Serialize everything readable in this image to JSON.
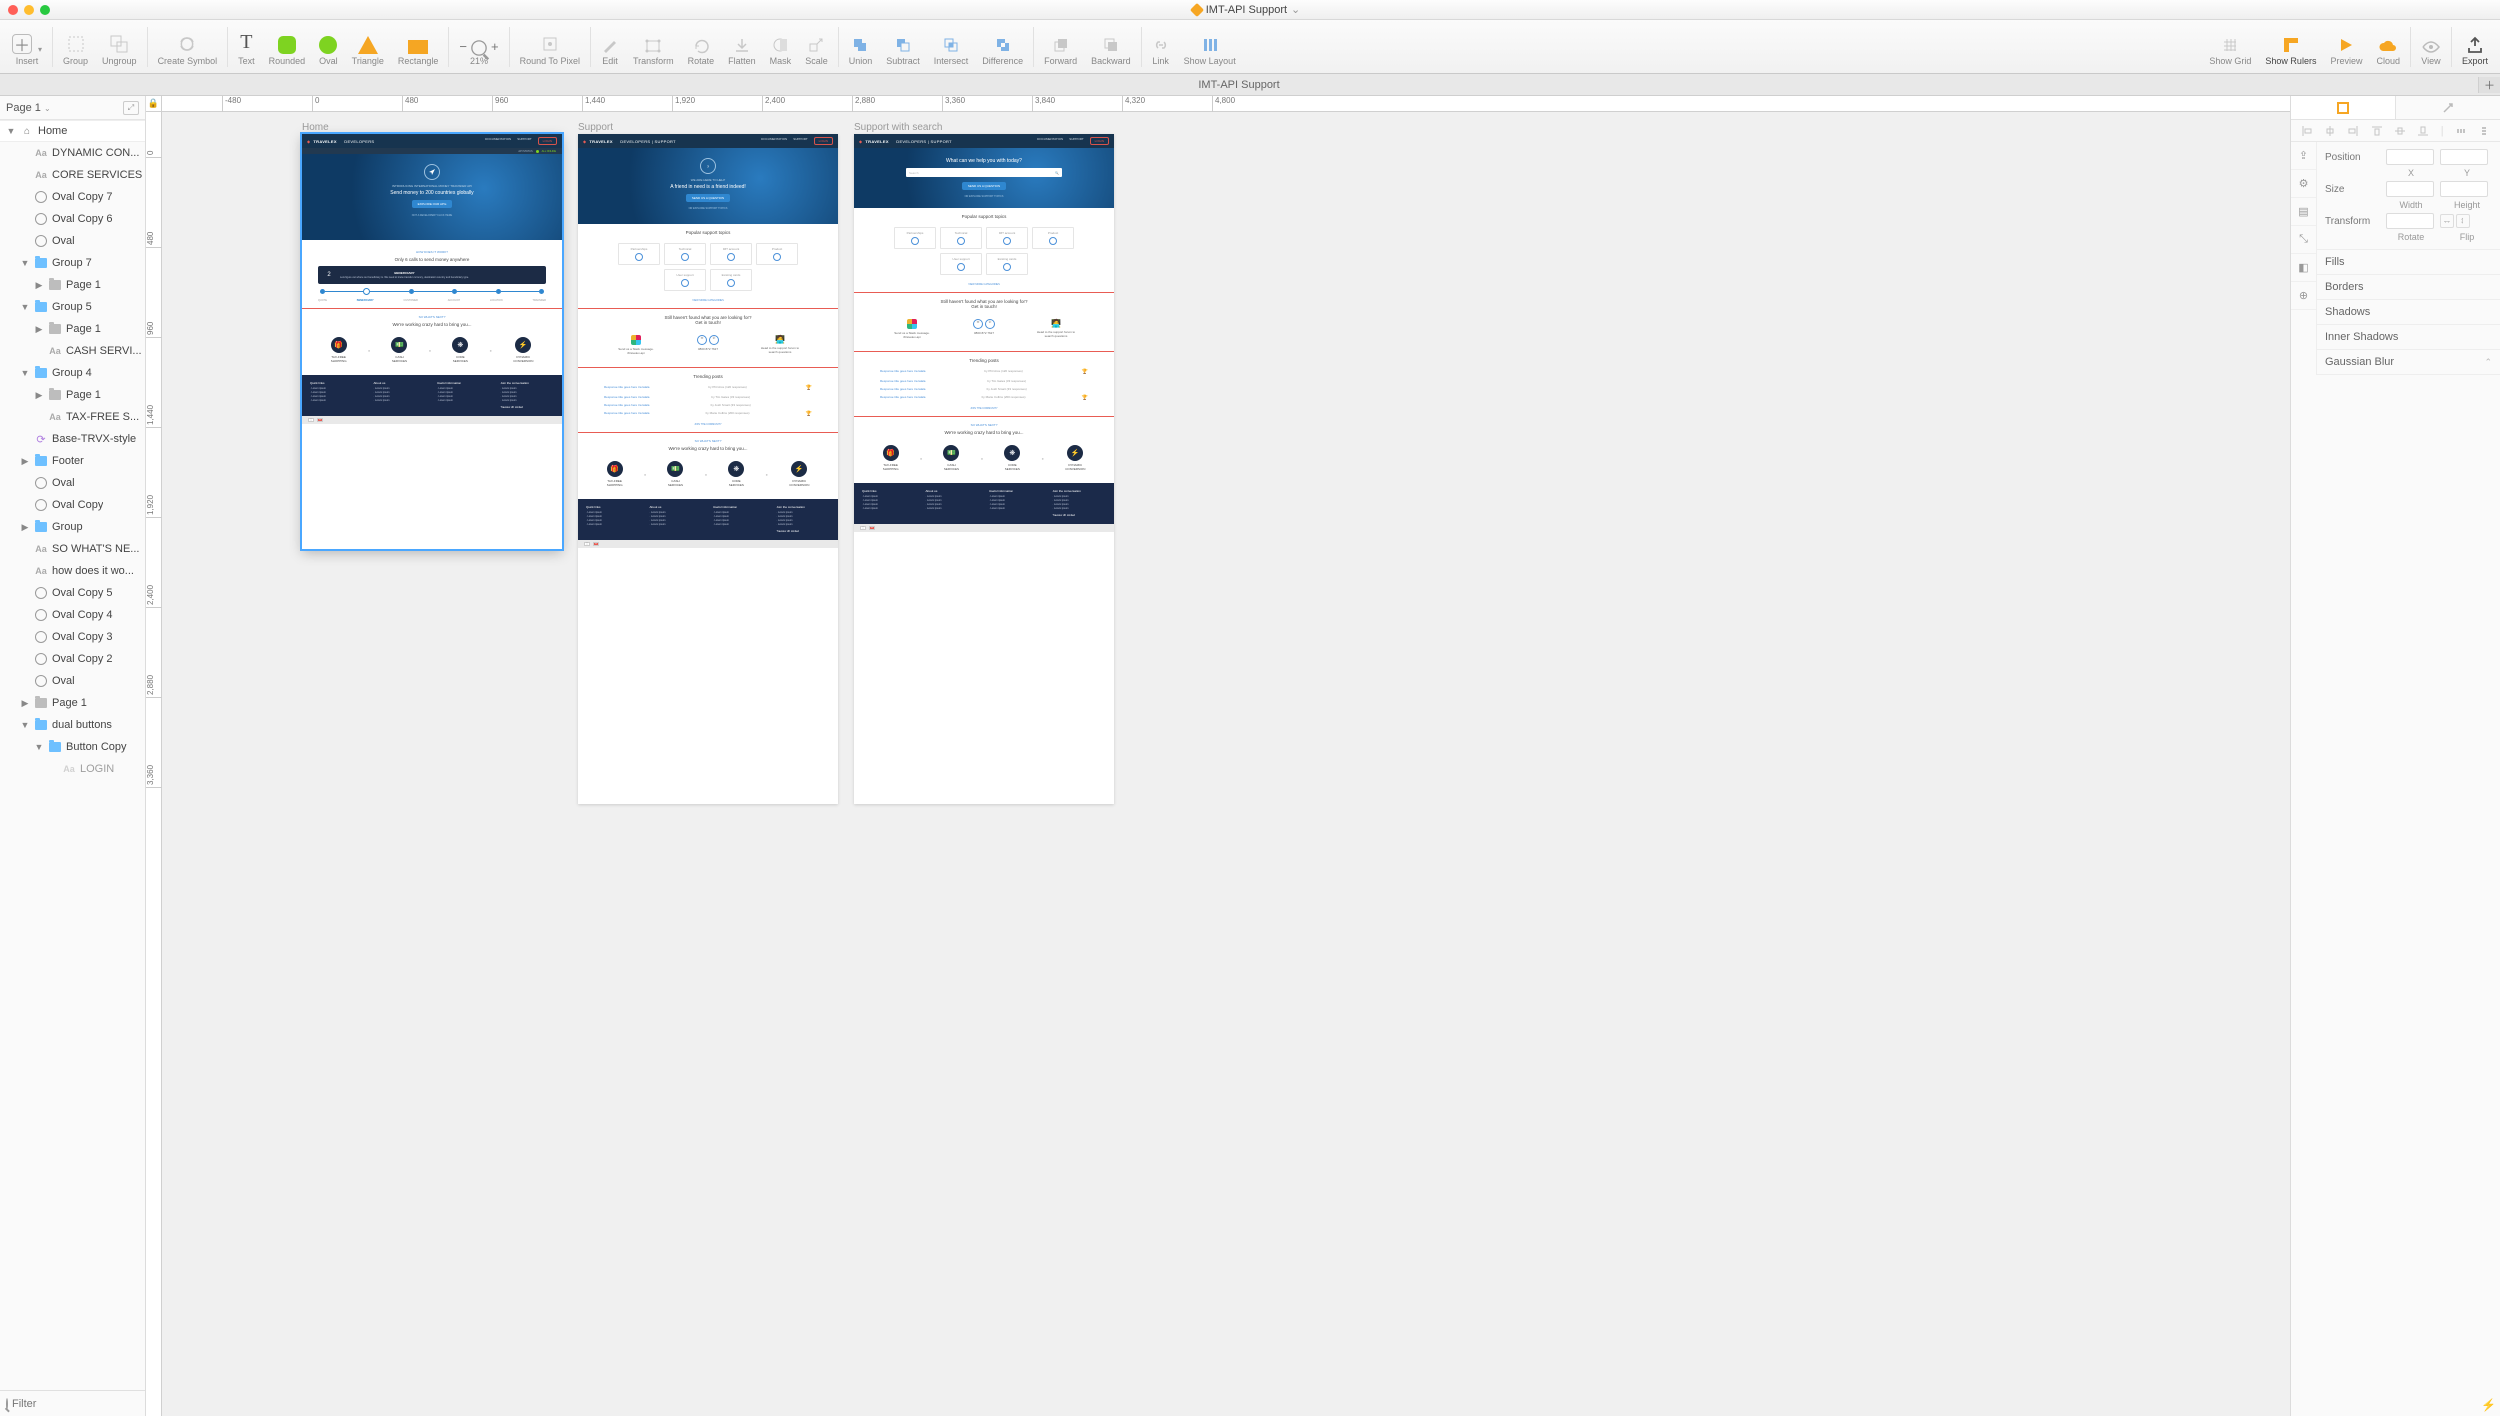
{
  "title": "IMT-API Support",
  "toolbar": {
    "insert": "Insert",
    "group": "Group",
    "ungroup": "Ungroup",
    "create_symbol": "Create Symbol",
    "text": "Text",
    "rounded": "Rounded",
    "oval": "Oval",
    "triangle": "Triangle",
    "rectangle": "Rectangle",
    "zoom_pct": "21%",
    "round_to_pixel": "Round To Pixel",
    "edit": "Edit",
    "transform": "Transform",
    "rotate": "Rotate",
    "flatten": "Flatten",
    "mask": "Mask",
    "scale": "Scale",
    "union": "Union",
    "subtract": "Subtract",
    "intersect": "Intersect",
    "difference": "Difference",
    "forward": "Forward",
    "backward": "Backward",
    "link": "Link",
    "show_layout": "Show Layout",
    "show_grid": "Show Grid",
    "show_rulers": "Show Rulers",
    "preview": "Preview",
    "cloud": "Cloud",
    "view": "View",
    "export": "Export"
  },
  "tab": "IMT-API Support",
  "page_dropdown": "Page 1",
  "layers": [
    {
      "type": "page",
      "label": "Home",
      "indent": 0,
      "disclosure": "▼"
    },
    {
      "type": "text",
      "label": "DYNAMIC CON...",
      "indent": 1
    },
    {
      "type": "text",
      "label": "CORE SERVICES",
      "indent": 1
    },
    {
      "type": "oval",
      "label": "Oval Copy 7",
      "indent": 1
    },
    {
      "type": "oval",
      "label": "Oval Copy 6",
      "indent": 1
    },
    {
      "type": "oval",
      "label": "Oval",
      "indent": 1
    },
    {
      "type": "folder",
      "label": "Group 7",
      "indent": 1,
      "disclosure": "▼"
    },
    {
      "type": "folder",
      "label": "Page 1",
      "indent": 2,
      "disclosure": "▶",
      "grey": true
    },
    {
      "type": "folder",
      "label": "Group 5",
      "indent": 1,
      "disclosure": "▼"
    },
    {
      "type": "folder",
      "label": "Page 1",
      "indent": 2,
      "disclosure": "▶",
      "grey": true
    },
    {
      "type": "text",
      "label": "CASH SERVI...",
      "indent": 2
    },
    {
      "type": "folder",
      "label": "Group 4",
      "indent": 1,
      "disclosure": "▼"
    },
    {
      "type": "folder",
      "label": "Page 1",
      "indent": 2,
      "disclosure": "▶",
      "grey": true
    },
    {
      "type": "text",
      "label": "TAX-FREE S...",
      "indent": 2
    },
    {
      "type": "symbol",
      "label": "Base-TRVX-style",
      "indent": 1
    },
    {
      "type": "folder",
      "label": "Footer",
      "indent": 1,
      "disclosure": "▶"
    },
    {
      "type": "oval",
      "label": "Oval",
      "indent": 1
    },
    {
      "type": "oval",
      "label": "Oval Copy",
      "indent": 1
    },
    {
      "type": "folder",
      "label": "Group",
      "indent": 1,
      "disclosure": "▶"
    },
    {
      "type": "text",
      "label": "SO WHAT'S NE...",
      "indent": 1
    },
    {
      "type": "text",
      "label": "how does it wo...",
      "indent": 1
    },
    {
      "type": "oval",
      "label": "Oval Copy 5",
      "indent": 1
    },
    {
      "type": "oval",
      "label": "Oval Copy 4",
      "indent": 1
    },
    {
      "type": "oval",
      "label": "Oval Copy 3",
      "indent": 1
    },
    {
      "type": "oval",
      "label": "Oval Copy 2",
      "indent": 1
    },
    {
      "type": "oval",
      "label": "Oval",
      "indent": 1
    },
    {
      "type": "folder",
      "label": "Page 1",
      "indent": 1,
      "disclosure": "▶",
      "grey": true
    },
    {
      "type": "folder",
      "label": "dual buttons",
      "indent": 1,
      "disclosure": "▼"
    },
    {
      "type": "folder",
      "label": "Button Copy",
      "indent": 2,
      "disclosure": "▼"
    },
    {
      "type": "text",
      "label": "LOGIN",
      "indent": 3,
      "dim": true
    }
  ],
  "filter_placeholder": "Filter",
  "ruler_h": [
    "-480",
    "0",
    "480",
    "960",
    "1,440",
    "1,920",
    "2,400",
    "2,880",
    "3,360",
    "3,840",
    "4,320",
    "4,800"
  ],
  "ruler_v": [
    "0",
    "480",
    "960",
    "1,440",
    "1,920",
    "2,400",
    "2,880",
    "3,360"
  ],
  "artboards": {
    "home_label": "Home",
    "support_label": "Support",
    "support_search_label": "Support with search"
  },
  "content": {
    "brand": "TRAVELEX",
    "brand_sub": "DEVELOPERS",
    "brand_sub2": "DEVELOPERS | SUPPORT",
    "nav_doc": "DOCUMENTATION",
    "nav_sup": "SUPPORT",
    "nav_login": "LOGIN",
    "api_status": "API STATUS",
    "all_online": "ALL ONLINE",
    "home_sub": "INTRODUCING INTERNATIONAL MONEY TRANSFER API",
    "home_ttl": "Send money to 200 countries globally",
    "home_cta": "EXPLORE OUR APIs",
    "home_cta2": "NOT A DEVELOPER? CLICK HERE",
    "how_lbl": "HOW DOES IT WORK?",
    "how_h": "Only 6 calls to send money anywhere",
    "step_box_title": "BENEFICIARY",
    "step_box_body": "Lets figure out where our beneficiary is. We need to know transfer currency, destination country and beneficiary type.",
    "steps": [
      "QUOTE",
      "BENEFICIARY",
      "CUSTOMER",
      "ACCOUNT",
      "LOCATION",
      "TRANSFER"
    ],
    "next_lbl": "SO WHAT'S NEXT?",
    "next_h": "We're working crazy hard to bring you...",
    "features": [
      "TAX-FREE SHOPPING",
      "CASH SERVICES",
      "CORE SERVICES",
      "DYNAMIC CONVERSION"
    ],
    "footer_cols": [
      "Quick links",
      "About us",
      "Useful information",
      "Join the conversation"
    ],
    "footer_company": "Travelex UK Limited",
    "sup_sub": "WE ARE HERE TO HELP",
    "sup_ttl": "A friend in need is a friend indeed!",
    "sup_cta": "SEND US A QUESTION",
    "sup_or": "OR EXPLORE SUPPORT TOPICS",
    "search_ttl": "What can we help you with today?",
    "search_ph": "Search",
    "pop_h": "Popular support topics",
    "topics": [
      "Partnerships",
      "Technical",
      "IMT account",
      "Product",
      "User support",
      "Existing cards"
    ],
    "more": "VIEW MORE CATEGORIES",
    "still_h1": "Still haven't found what you are looking for?",
    "still_h2": "Get in touch!",
    "contact1a": "Send us a Slack message.",
    "contact1b": "#travelex-api",
    "contact2": "0800 872 7627",
    "contact3": "Head to the support forum to search questions",
    "trend_h": "Trending posts",
    "trend_item": "Response title goes here tra lalala",
    "by1": "by Phil Arce",
    "r1": "(120 responses)",
    "by2": "by Tim Gates",
    "r2": "(33 responses)",
    "by3": "by Josh Smart",
    "r3": "(33 responses)",
    "by4": "by Marie Collins",
    "r4": "(200 responses)",
    "join": "JOIN THE COMMUNITY"
  },
  "inspector": {
    "position": "Position",
    "x": "X",
    "y": "Y",
    "size": "Size",
    "width": "Width",
    "height": "Height",
    "transform": "Transform",
    "rotate": "Rotate",
    "flip": "Flip",
    "fills": "Fills",
    "borders": "Borders",
    "shadows": "Shadows",
    "inner_shadows": "Inner Shadows",
    "blur": "Gaussian Blur"
  }
}
